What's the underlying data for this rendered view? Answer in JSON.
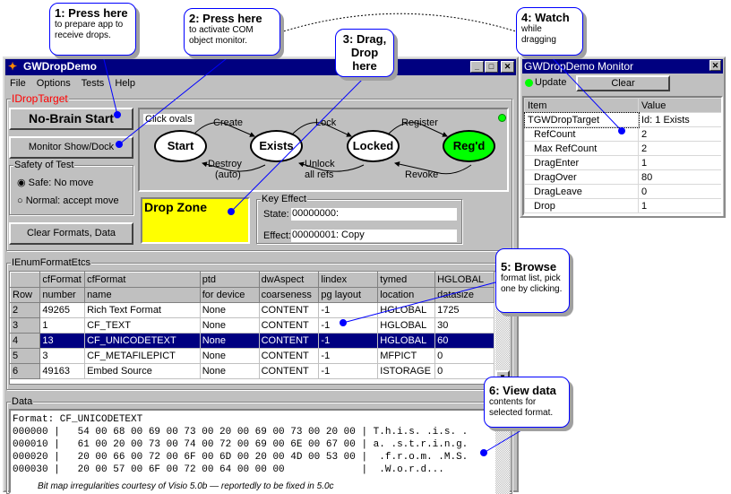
{
  "main_window": {
    "title": "GWDropDemo",
    "menu": [
      "File",
      "Options",
      "Tests",
      "Help"
    ]
  },
  "drop_target": {
    "group_label": "IDropTarget",
    "no_brain_start": "No-Brain Start",
    "monitor_show_dock": "Monitor Show/Dock",
    "safety": {
      "label": "Safety of Test",
      "options": [
        "Safe: No move",
        "Normal: accept move"
      ],
      "selected": 0
    },
    "clear_formats": "Clear Formats, Data",
    "diagram": {
      "hint": "Click ovals",
      "states": [
        "Start",
        "Exists",
        "Locked",
        "Reg'd"
      ],
      "transitions": {
        "create": "Create",
        "lock": "Lock",
        "register": "Register",
        "destroy": "Destroy",
        "auto": "(auto)",
        "unlock": "Unlock",
        "all_refs": "all refs",
        "revoke": "Revoke"
      },
      "active_state_color": "#00ff00"
    },
    "drop_zone": "Drop Zone",
    "key_effect": {
      "label": "Key Effect",
      "state_label": "State:",
      "state_value": "00000000:",
      "effect_label": "Effect:",
      "effect_value": "00000001: Copy"
    }
  },
  "formats": {
    "group_label": "IEnumFormatEtcs",
    "header1": [
      "",
      "cfFormat",
      "cfFormat",
      "ptd",
      "dwAspect",
      "lindex",
      "tymed",
      "HGLOBAL"
    ],
    "header2": [
      "Row",
      "number",
      "name",
      "for device",
      "coarseness",
      "pg layout",
      "location",
      "datasize"
    ],
    "rows": [
      [
        "2",
        "49265",
        "Rich Text Format",
        "None",
        "CONTENT",
        "-1",
        "HGLOBAL",
        "1725"
      ],
      [
        "3",
        "1",
        "CF_TEXT",
        "None",
        "CONTENT",
        "-1",
        "HGLOBAL",
        "30"
      ],
      [
        "4",
        "13",
        "CF_UNICODETEXT",
        "None",
        "CONTENT",
        "-1",
        "HGLOBAL",
        "60"
      ],
      [
        "5",
        "3",
        "CF_METAFILEPICT",
        "None",
        "CONTENT",
        "-1",
        "MFPICT",
        "0"
      ],
      [
        "6",
        "49163",
        "Embed Source",
        "None",
        "CONTENT",
        "-1",
        "ISTORAGE",
        "0"
      ]
    ],
    "selected_row": 2
  },
  "data_panel": {
    "label": "Data",
    "lines": [
      "Format: CF_UNICODETEXT",
      "000000 |   54 00 68 00 69 00 73 00 20 00 69 00 73 00 20 00 | T.h.i.s. .i.s. .",
      "000010 |   61 00 20 00 73 00 74 00 72 00 69 00 6E 00 67 00 | a. .s.t.r.i.n.g.",
      "000020 |   20 00 66 00 72 00 6F 00 6D 00 20 00 4D 00 53 00 |  .f.r.o.m. .M.S.",
      "000030 |   20 00 57 00 6F 00 72 00 64 00 00 00             |  .W.o.r.d..."
    ],
    "note": "Bit map irregularities courtesy of Visio 5.0b — reportedly to be fixed in 5.0c"
  },
  "monitor": {
    "title": "GWDropDemo Monitor",
    "update": "Update",
    "clear": "Clear",
    "columns": [
      "Item",
      "Value"
    ],
    "rows": [
      [
        "TGWDropTarget",
        "Id: 1 Exists"
      ],
      [
        "RefCount",
        "2"
      ],
      [
        "Max RefCount",
        "2"
      ],
      [
        "DragEnter",
        "1"
      ],
      [
        "DragOver",
        "80"
      ],
      [
        "DragLeave",
        "0"
      ],
      [
        "Drop",
        "1"
      ]
    ]
  },
  "callouts": [
    {
      "title": "1: Press here",
      "text": "to prepare app to receive drops."
    },
    {
      "title": "2: Press here",
      "text": "to activate COM object monitor."
    },
    {
      "title": "3: Drag, Drop here",
      "text": ""
    },
    {
      "title": "4: Watch",
      "text": "while dragging"
    },
    {
      "title": "5: Browse",
      "text": "format list, pick one by clicking."
    },
    {
      "title": "6: View data",
      "text": "contents for selected format."
    }
  ]
}
